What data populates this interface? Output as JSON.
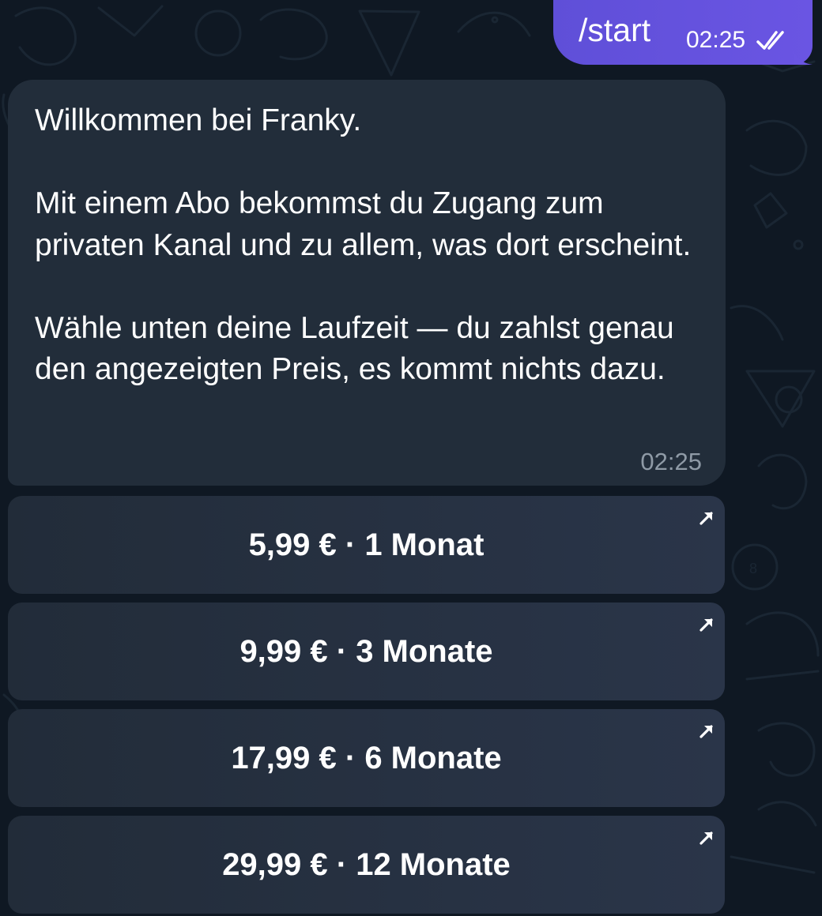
{
  "chat": {
    "outgoing": {
      "text": "/start",
      "time": "02:25",
      "status_icon": "double-check-icon"
    },
    "incoming": {
      "text": "Willkommen bei Franky.\n\nMit einem Abo bekommst du Zugang zum privaten Kanal und zu allem, was dort erscheint.\n\nWähle unten deine Laufzeit — du zahlst genau den angezeigten Preis, es kommt nichts dazu.",
      "time": "02:25"
    }
  },
  "inline_buttons": [
    {
      "label": "5,99 € · 1 Monat",
      "icon": "external-link-arrow-icon"
    },
    {
      "label": "9,99 € · 3 Monate",
      "icon": "external-link-arrow-icon"
    },
    {
      "label": "17,99 € · 6 Monate",
      "icon": "external-link-arrow-icon"
    },
    {
      "label": "29,99 € · 12 Monate",
      "icon": "external-link-arrow-icon"
    }
  ],
  "colors": {
    "background": "#0f1823",
    "incoming_bubble": "#222d3a",
    "outgoing_bubble": "#6a55e3",
    "button": "#26313f",
    "muted_text": "#8f9aa6"
  }
}
